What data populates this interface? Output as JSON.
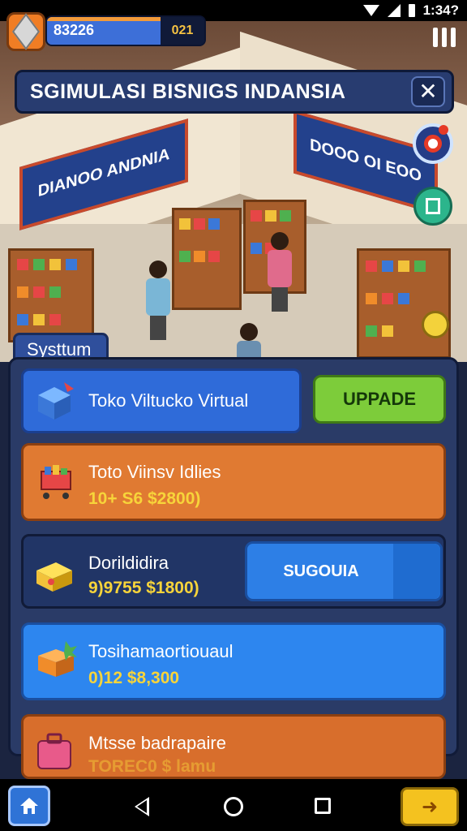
{
  "status_bar": {
    "time": "1:34?"
  },
  "hud": {
    "score": "83226",
    "level": "021",
    "progress": 0.74
  },
  "title": "SGIMULASI BISNIGS INDANSIA",
  "scene": {
    "sign_left": "DIANOO ANDNIA",
    "sign_right": "DOOO OI EOO"
  },
  "panel": {
    "tab_label": "Systtum",
    "upgrade_item": {
      "name": "Toko Viltucko Virtual",
      "button": "UPPADE"
    },
    "items": [
      {
        "name": "Toto Viinsv Idlies",
        "price": "10+ S6 $2800)"
      },
      {
        "name": "Dorildidira",
        "price": "9)9755 $1800)",
        "button": "SUGOUIA"
      },
      {
        "name": "Tosihamaortiouaul",
        "price": "0)12 $8,300"
      },
      {
        "name": "Mtsse badrapaire",
        "price": "TOREC0 $ lamu"
      }
    ]
  },
  "colors": {
    "upgrade": "#7dcc3a",
    "orange_card": "#e07a32",
    "blue_card": "#2d86ef",
    "panel": "#2a3b67"
  },
  "icons": [
    "box-icon",
    "shopping-cart-icon",
    "yellow-box-icon",
    "package-icon",
    "suitcase-icon",
    "home-icon",
    "next-icon",
    "target-icon",
    "document-icon"
  ]
}
